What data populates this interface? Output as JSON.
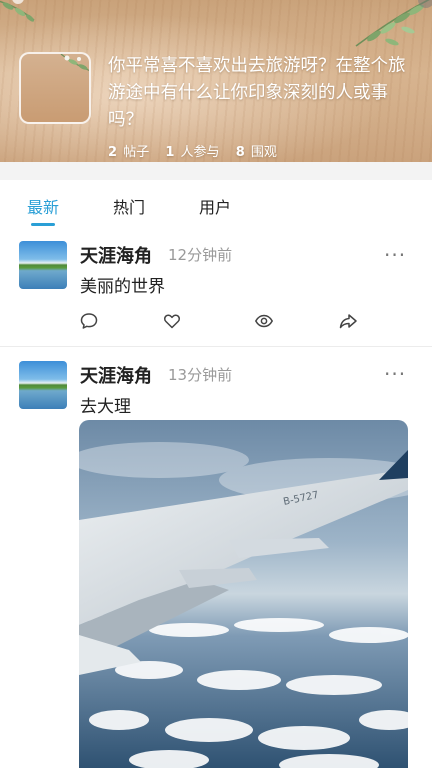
{
  "topic": {
    "title": "你平常喜不喜欢出去旅游呀？在整个旅游途中有什么让你印象深刻的人或事吗？",
    "stats": [
      {
        "num": "2",
        "label": "帖子"
      },
      {
        "num": "1",
        "label": "人参与"
      },
      {
        "num": "8",
        "label": "围观"
      }
    ]
  },
  "tabs": [
    {
      "label": "最新",
      "active": true
    },
    {
      "label": "热门",
      "active": false
    },
    {
      "label": "用户",
      "active": false
    }
  ],
  "posts": [
    {
      "author": "天涯海角",
      "time": "12分钟前",
      "text": "美丽的世界",
      "more": "···"
    },
    {
      "author": "天涯海角",
      "time": "13分钟前",
      "text": "去大理",
      "more": "···",
      "photo_id": "B-5727"
    }
  ],
  "colors": {
    "accent": "#2a9fd6",
    "muted": "#9a9a9a"
  },
  "icons": {
    "actions": [
      "comment-icon",
      "like-heart-icon",
      "view-eye-icon",
      "share-icon"
    ]
  }
}
